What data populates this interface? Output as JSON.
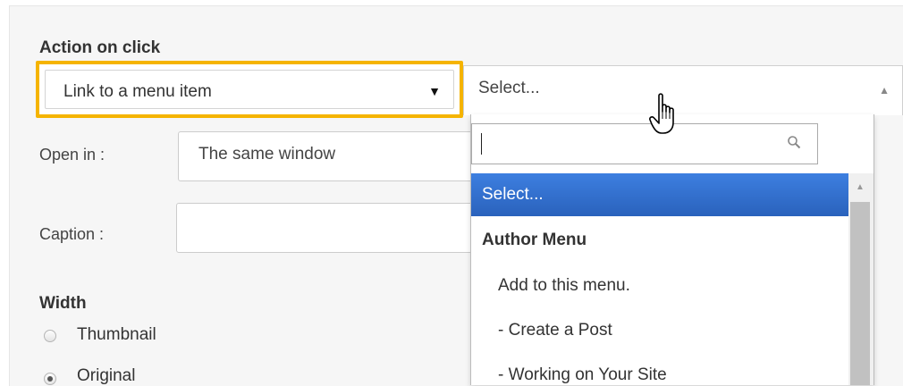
{
  "action_on_click": {
    "label": "Action on click",
    "selected": "Link to a menu item",
    "caret": "▼"
  },
  "menu_item_select": {
    "value": "Select...",
    "arrow": "▲"
  },
  "open_in": {
    "label": "Open in :",
    "value": "The same window"
  },
  "caption": {
    "label": "Caption :",
    "value": ""
  },
  "width": {
    "label": "Width",
    "options": [
      {
        "label": "Thumbnail",
        "checked": false
      },
      {
        "label": "Original",
        "checked": true
      }
    ]
  },
  "dropdown": {
    "search_value": "",
    "options": [
      {
        "label": "Select...",
        "highlighted": true,
        "group": false
      },
      {
        "label": "Author Menu",
        "highlighted": false,
        "group": true
      },
      {
        "label": "Add to this menu.",
        "highlighted": false,
        "group": false
      },
      {
        "label": "- Create a Post",
        "highlighted": false,
        "group": false
      },
      {
        "label": "- Working on Your Site",
        "highlighted": false,
        "group": false
      }
    ]
  },
  "colors": {
    "highlight": "#f5b400",
    "selection": "#3875d7",
    "panel_background": "#f6f6f6"
  },
  "icons": {
    "search": "search-icon",
    "cursor": "hand-pointer-icon"
  }
}
